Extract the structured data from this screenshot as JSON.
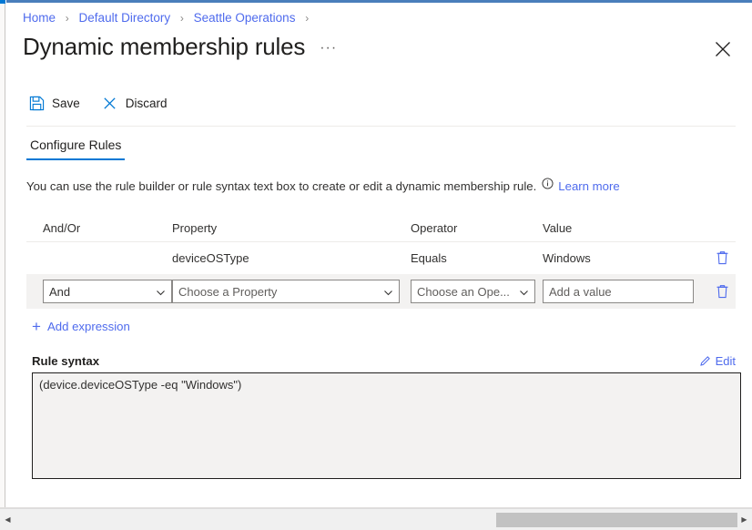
{
  "breadcrumb": {
    "items": [
      {
        "label": "Home"
      },
      {
        "label": "Default Directory"
      },
      {
        "label": "Seattle Operations"
      }
    ],
    "separator": "›"
  },
  "header": {
    "title": "Dynamic membership rules",
    "ellipsis": "···",
    "close_icon": "close-icon"
  },
  "toolbar": {
    "save_label": "Save",
    "save_icon": "save-floppy-icon",
    "discard_label": "Discard",
    "discard_icon": "discard-x-icon"
  },
  "tabs": [
    {
      "label": "Configure Rules",
      "selected": true
    }
  ],
  "description": {
    "text": "You can use the rule builder or rule syntax text box to create or edit a dynamic membership rule.",
    "info_icon": "info-circle-icon",
    "learn_more": "Learn more"
  },
  "rules_table": {
    "columns": {
      "andor": "And/Or",
      "property": "Property",
      "operator": "Operator",
      "value": "Value"
    },
    "existing_row": {
      "andor": "",
      "property": "deviceOSType",
      "operator": "Equals",
      "value": "Windows",
      "delete_icon": "trash-icon"
    },
    "editor_row": {
      "andor_selected": "And",
      "property_placeholder": "Choose a Property",
      "operator_placeholder": "Choose an Ope...",
      "value_placeholder": "Add a value",
      "delete_icon": "trash-icon",
      "chevron_icon": "chevron-down-icon"
    }
  },
  "add_expression": {
    "label": "Add expression",
    "plus": "+"
  },
  "rule_syntax": {
    "label": "Rule syntax",
    "edit_label": "Edit",
    "edit_icon": "pencil-icon",
    "content": "(device.deviceOSType -eq \"Windows\")"
  },
  "scrollbar": {
    "left_arrow": "◀",
    "right_arrow": "▶"
  },
  "colors": {
    "accent": "#0078d4",
    "link": "#4f6bed",
    "blade_top": "#4a7ebb",
    "row_editor_bg": "#f3f2f1"
  }
}
